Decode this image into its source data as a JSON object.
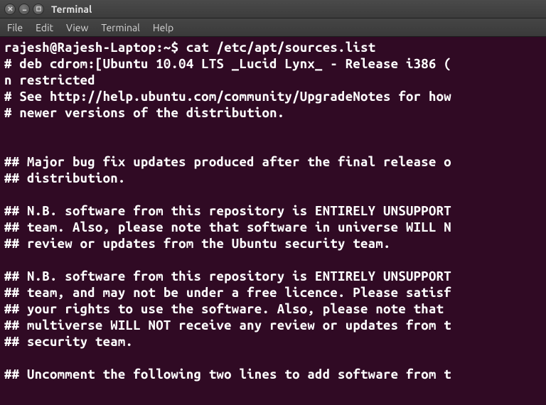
{
  "window": {
    "title": "Terminal"
  },
  "menu": {
    "file": "File",
    "edit": "Edit",
    "view": "View",
    "terminal": "Terminal",
    "help": "Help"
  },
  "terminal": {
    "prompt_user_host": "rajesh@Rajesh-Laptop",
    "prompt_path": "~",
    "prompt_symbol": "$",
    "command": "cat /etc/apt/sources.list",
    "output_lines": [
      "# deb cdrom:[Ubuntu 10.04 LTS _Lucid Lynx_ - Release i386 (",
      "n restricted",
      "# See http://help.ubuntu.com/community/UpgradeNotes for how",
      "# newer versions of the distribution.",
      "",
      "",
      "## Major bug fix updates produced after the final release o",
      "## distribution.",
      "",
      "## N.B. software from this repository is ENTIRELY UNSUPPORT",
      "## team. Also, please note that software in universe WILL N",
      "## review or updates from the Ubuntu security team.",
      "",
      "## N.B. software from this repository is ENTIRELY UNSUPPORT",
      "## team, and may not be under a free licence. Please satisf",
      "## your rights to use the software. Also, please note that",
      "## multiverse WILL NOT receive any review or updates from t",
      "## security team.",
      "",
      "## Uncomment the following two lines to add software from t"
    ]
  }
}
